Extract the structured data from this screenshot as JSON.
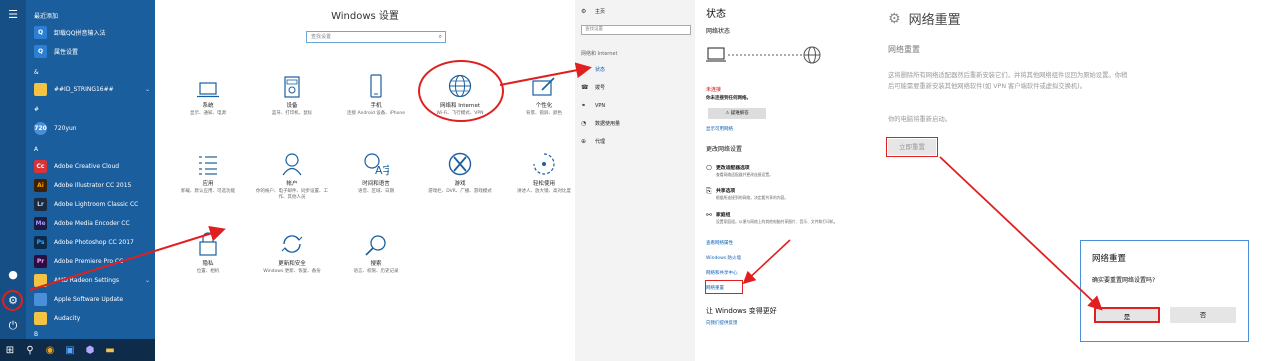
{
  "start_menu": {
    "recent_header": "最近添加",
    "items": [
      {
        "label": "卸载QQ拼音输入法",
        "icon": "qq-uninstall-icon",
        "color": "#2d7fd3"
      },
      {
        "label": "属性设置",
        "icon": "properties-icon",
        "color": "#2d7fd3"
      }
    ],
    "section_amp": "&",
    "string_item": "##ID_STRING16##",
    "section_hash": "#",
    "item_720": "720yun",
    "section_a": "A",
    "apps": [
      {
        "label": "Adobe Creative Cloud",
        "badge": "Cc",
        "color": "#d9333a"
      },
      {
        "label": "Adobe Illustrator CC 2015",
        "badge": "Ai",
        "color": "#3a2208"
      },
      {
        "label": "Adobe Lightroom Classic CC",
        "badge": "Lr",
        "color": "#1c2a3c"
      },
      {
        "label": "Adobe Media Encoder CC",
        "badge": "Me",
        "color": "#1d1a3c"
      },
      {
        "label": "Adobe Photoshop CC 2017",
        "badge": "Ps",
        "color": "#0b2a4a"
      },
      {
        "label": "Adobe Premiere Pro CC",
        "badge": "Pr",
        "color": "#2a0e3c"
      },
      {
        "label": "AMD Radeon Settings",
        "badge": "",
        "color": "#f3c443"
      },
      {
        "label": "Apple Software Update",
        "badge": "",
        "color": "#4a8fd8"
      },
      {
        "label": "Audacity",
        "badge": "",
        "color": "#f3c443"
      }
    ],
    "section_b": "B"
  },
  "settings_home": {
    "title": "Windows 设置",
    "search_placeholder": "查找设置",
    "tiles": [
      {
        "name": "系统",
        "desc": "显示、通知、电源",
        "icon": "laptop-icon"
      },
      {
        "name": "设备",
        "desc": "蓝牙、打印机、鼠标",
        "icon": "keyboard-icon"
      },
      {
        "name": "手机",
        "desc": "连接 Android 设备、iPhone",
        "icon": "phone-icon"
      },
      {
        "name": "网络和 Internet",
        "desc": "Wi-Fi、飞行模式、VPN",
        "icon": "globe-icon"
      },
      {
        "name": "个性化",
        "desc": "背景、锁屏、颜色",
        "icon": "brush-icon"
      },
      {
        "name": "应用",
        "desc": "卸载、默认应用、可选功能",
        "icon": "apps-list-icon"
      },
      {
        "name": "帐户",
        "desc": "你的帐户、电子邮件、同步设置、工作、其他人员",
        "icon": "person-icon"
      },
      {
        "name": "时间和语言",
        "desc": "语音、区域、日期",
        "icon": "time-language-icon"
      },
      {
        "name": "游戏",
        "desc": "游戏栏、DVR、广播、游戏模式",
        "icon": "xbox-icon"
      },
      {
        "name": "轻松使用",
        "desc": "讲述人、放大镜、高对比度",
        "icon": "ease-of-access-icon"
      },
      {
        "name": "隐私",
        "desc": "位置、相机",
        "icon": "lock-icon"
      },
      {
        "name": "更新和安全",
        "desc": "Windows 更新、恢复、备份",
        "icon": "update-icon"
      },
      {
        "name": "搜索",
        "desc": "语言、权限、历史记录",
        "icon": "search-icon"
      }
    ]
  },
  "nav": {
    "home": "主页",
    "search_placeholder": "查找设置",
    "section": "网络和 Internet",
    "items": [
      {
        "label": "状态",
        "icon": "status-icon"
      },
      {
        "label": "拨号",
        "icon": "dialup-icon"
      },
      {
        "label": "VPN",
        "icon": "vpn-icon"
      },
      {
        "label": "数据使用量",
        "icon": "data-usage-icon"
      },
      {
        "label": "代理",
        "icon": "proxy-icon"
      }
    ]
  },
  "status_page": {
    "title": "状态",
    "network_status": "网络状态",
    "not_connected": "未连接",
    "not_connected_desc": "你未连接到任何网络。",
    "troubleshoot": "疑难解答",
    "show_networks": "显示可用网络",
    "change_settings": "更改网络设置",
    "options": [
      {
        "title": "更改适配器选项",
        "desc": "查看网络适配器并更改连接设置。",
        "icon": "adapter-icon"
      },
      {
        "title": "共享选项",
        "desc": "根据所连接到的网络，决定要共享的内容。",
        "icon": "sharing-icon"
      },
      {
        "title": "家庭组",
        "desc": "设置家庭组，以便与网络上的其他电脑共享图片、音乐、文件和打印机。",
        "icon": "homegroup-icon"
      }
    ],
    "links": [
      "查看网络属性",
      "Windows 防火墙",
      "网络和共享中心",
      "网络重置"
    ],
    "make_better": "让 Windows 变得更好",
    "feedback": "向我们提供反馈"
  },
  "reset_page": {
    "title": "网络重置",
    "heading": "网络重置",
    "desc": "这将删除所有网络适配器然后重新安装它们，并将其他网络组件设回为原始设置。你稍后可能需要重新安装其他网络软件(如 VPN 客户端软件或虚拟交换机)。",
    "restart_note": "你的电脑将重新启动。",
    "reset_now": "立即重置"
  },
  "dialog": {
    "title": "网络重置",
    "question": "确实要重置网络设置吗?",
    "yes": "是",
    "no": "否"
  },
  "accent": "#e02020"
}
